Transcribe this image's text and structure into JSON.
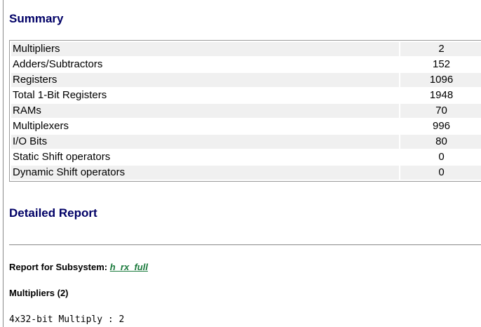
{
  "summary": {
    "heading": "Summary",
    "rows": [
      {
        "label": "Multipliers",
        "value": "2"
      },
      {
        "label": "Adders/Subtractors",
        "value": "152"
      },
      {
        "label": "Registers",
        "value": "1096"
      },
      {
        "label": "Total 1-Bit Registers",
        "value": "1948"
      },
      {
        "label": "RAMs",
        "value": "70"
      },
      {
        "label": "Multiplexers",
        "value": "996"
      },
      {
        "label": "I/O Bits",
        "value": "80"
      },
      {
        "label": "Static Shift operators",
        "value": "0"
      },
      {
        "label": "Dynamic Shift operators",
        "value": "0"
      }
    ]
  },
  "detailed": {
    "heading": "Detailed Report",
    "subsystem_label": "Report for Subsystem:",
    "subsystem_link": "h_rx_full",
    "multipliers_heading": "Multipliers (2)",
    "multipliers_line": "4x32-bit Multiply : 2"
  },
  "colors": {
    "heading": "#000066",
    "link": "#1a7a3c",
    "row_shade": "#f0f0f0"
  }
}
